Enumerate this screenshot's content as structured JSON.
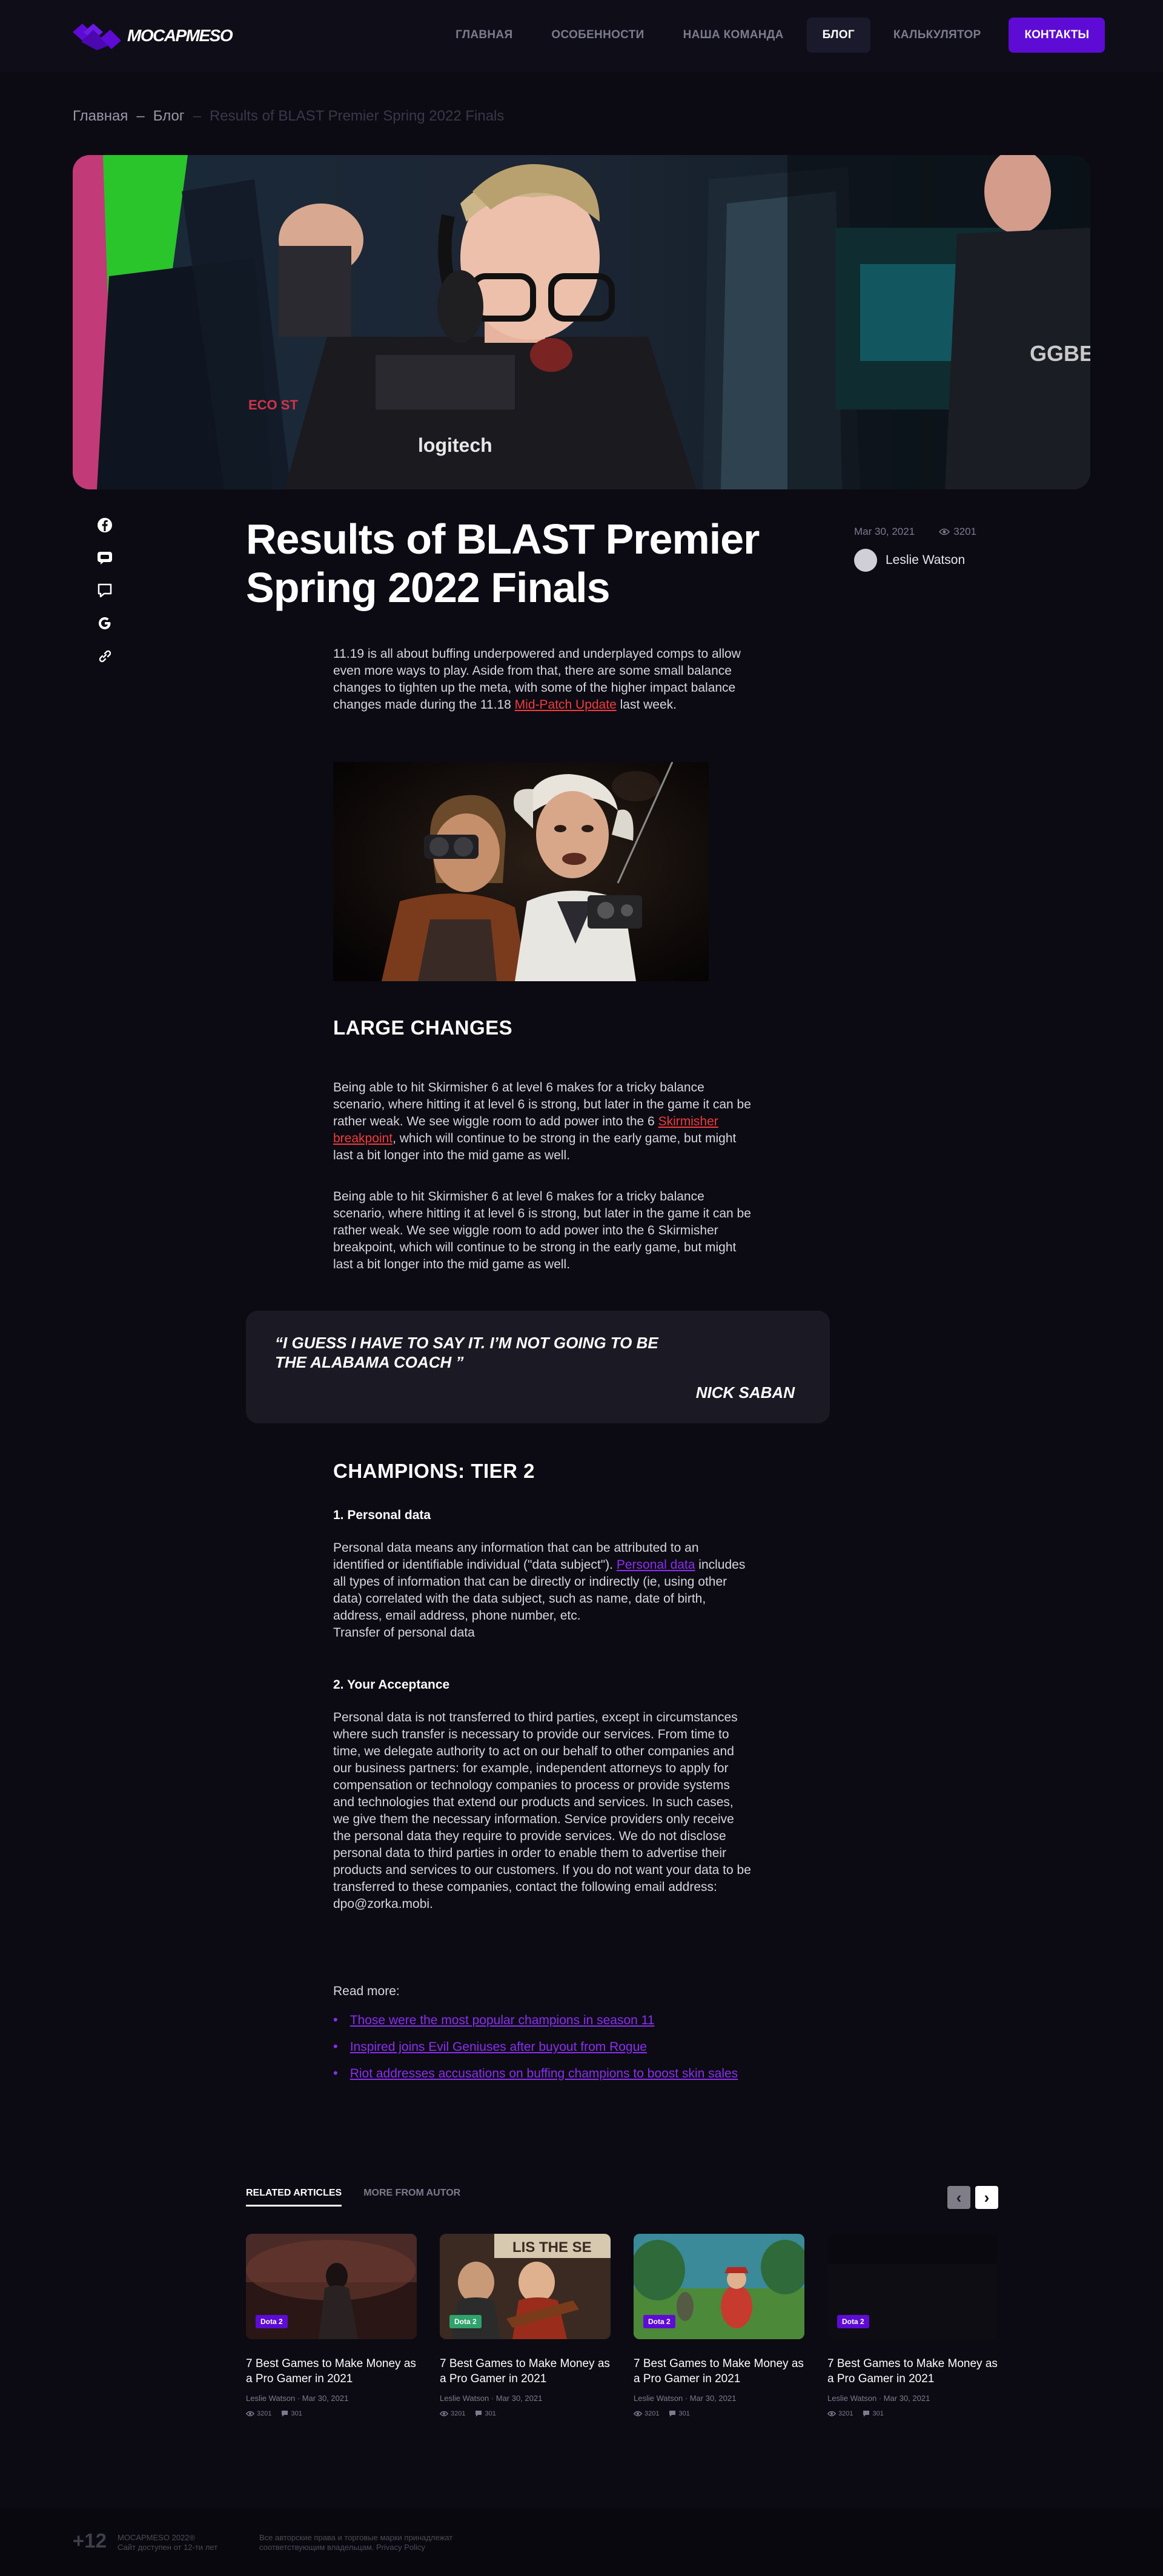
{
  "header": {
    "logo_text": "MOCAPMESO",
    "nav": [
      "ГЛАВНАЯ",
      "ОСОБЕННОСТИ",
      "НАША КОМАНДА",
      "БЛОГ",
      "КАЛЬКУЛЯТОР"
    ],
    "contact": "КОНТАКТЫ"
  },
  "breadcrumb": {
    "home": "Главная",
    "sep1": "–",
    "blog": "Блог",
    "sep2": "–",
    "current": "Results of BLAST Premier Spring 2022 Finals"
  },
  "article": {
    "title": "Results of BLAST Premier Spring 2022 Finals",
    "date": "Mar 30, 2021",
    "views": "3201",
    "author": "Leslie Watson",
    "intro_before": "11.19 is all about buffing underpowered and underplayed comps to allow even more ways to play. Aside from that, there are some small balance changes to tighten up the meta, with some of the higher impact balance changes made during the 11.18 ",
    "intro_link": "Mid-Patch Update",
    "intro_after": " last week.",
    "h_large_changes": "LARGE CHANGES",
    "p1_before": "Being able to hit Skirmisher 6 at level 6 makes for a tricky balance scenario, where hitting it at level 6 is strong, but later in the game it can be rather weak. We see wiggle room to add power into the 6 ",
    "p1_link": "Skirmisher breakpoint",
    "p1_after": ", which will continue to be strong in the early game, but might last a bit longer into the mid game as well.",
    "p2": "Being able to hit Skirmisher 6 at level 6 makes for a tricky balance scenario, where hitting it at level 6 is strong, but later in the game it can be rather weak. We see wiggle room to add power into the 6 Skirmisher breakpoint, which will continue to be strong in the early game, but might last a bit longer into the mid game as well.",
    "quote": "“I GUESS I HAVE TO SAY IT. I’M NOT GOING TO BE THE ALABAMA COACH ”",
    "quote_author": "NICK SABAN",
    "h_champions": "CHAMPIONS: TIER 2",
    "h_personal": "1. Personal data",
    "personal_before": "Personal data means any information that can be attributed to an identified or identifiable individual (\"data subject\"). ",
    "personal_link": "Personal data",
    "personal_after": " includes all types of information that can be directly or indirectly (ie, using other data) correlated with the data subject, such as name, date of birth, address, email address, phone number, etc.",
    "personal_transfer": "Transfer of personal data",
    "h_acceptance": "2. Your Acceptance",
    "acceptance": "Personal data is not transferred to third parties, except in circumstances where such transfer is necessary to provide our services. From time to time, we delegate authority to act on our behalf to other companies and our business partners: for example, independent attorneys to apply for compensation or technology companies to process or provide systems and technologies that extend our products and services. In such cases, we give them the necessary information. Service providers only receive the personal data they require to provide services. We do not disclose personal data to third parties in order to enable them to advertise their products and services to our customers. If you do not want your data to be transferred to these companies, contact the following email address: dpo@zorka.mobi.",
    "read_more": "Read more:",
    "read_more_links": [
      "Those were the most popular champions in season 11",
      "Inspired joins Evil Geniuses after buyout from Rogue",
      "Riot addresses accusations on buffing champions to boost skin sales"
    ]
  },
  "related": {
    "tab_related": "RELATED ARTICLES",
    "tab_author": "MORE FROM AUTOR",
    "cards": [
      {
        "badge": "Dota 2",
        "badge_color": "#5f0bd6",
        "title": "7 Best Games to Make Money as a Pro Gamer in 2021",
        "meta": "Leslie Watson  ·  Mar 30, 2021",
        "views": "3201",
        "comments": "301"
      },
      {
        "badge": "Dota 2",
        "badge_color": "#2fa36b",
        "title": "7 Best Games to Make Money as a Pro Gamer in 2021",
        "meta": "Leslie Watson  ·  Mar 30, 2021",
        "views": "3201",
        "comments": "301"
      },
      {
        "badge": "Dota 2",
        "badge_color": "#5f0bd6",
        "title": "7 Best Games to Make Money as a Pro Gamer in 2021",
        "meta": "Leslie Watson  ·  Mar 30, 2021",
        "views": "3201",
        "comments": "301"
      },
      {
        "badge": "Dota 2",
        "badge_color": "#5f0bd6",
        "title": "7 Best Games to Make Money as a Pro Gamer in 2021",
        "meta": "Leslie Watson  ·  Mar 30, 2021",
        "views": "3201",
        "comments": "301"
      }
    ]
  },
  "footer": {
    "age": "+12",
    "brand_line1": "MOCAPMESO 2022®",
    "brand_line2": "Сайт доступен от 12-ти лет",
    "copy_line1": "Все авторские права и торговые марки принадлежат",
    "copy_line2": "соответствующим владельцам. Privacy Policy"
  }
}
